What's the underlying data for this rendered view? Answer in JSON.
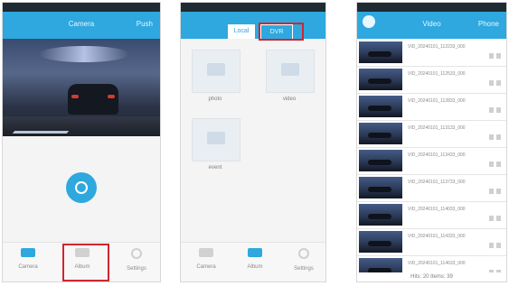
{
  "screens": [
    {
      "titlebar": {
        "title": "Camera",
        "right": "Push"
      },
      "tabs": [
        {
          "label": "Camera",
          "icon": "camera-icon"
        },
        {
          "label": "Album",
          "icon": "album-icon"
        },
        {
          "label": "Settings",
          "icon": "gear-icon"
        }
      ],
      "highlight": "Album"
    },
    {
      "segments": {
        "local": "Local",
        "dvr": "DVR"
      },
      "albums": [
        {
          "label": "photo"
        },
        {
          "label": "video"
        },
        {
          "label": "event"
        }
      ],
      "tabs": [
        {
          "label": "Camera"
        },
        {
          "label": "Album"
        },
        {
          "label": "Settings"
        }
      ]
    },
    {
      "titlebar": {
        "title": "Video",
        "right": "Phone"
      },
      "videos": [
        {
          "name": "VID_20240101_112233_000"
        },
        {
          "name": "VID_20240101_112533_000"
        },
        {
          "name": "VID_20240101_112833_000"
        },
        {
          "name": "VID_20240101_113133_000"
        },
        {
          "name": "VID_20240101_113433_000"
        },
        {
          "name": "VID_20240101_113733_000"
        },
        {
          "name": "VID_20240101_114033_000"
        },
        {
          "name": "VID_20240101_114333_000"
        },
        {
          "name": "VID_20240101_114633_000"
        }
      ],
      "footer": "Hits: 20 Items: 39"
    }
  ],
  "colors": {
    "accent": "#2ea8df",
    "highlight": "#d0262f"
  }
}
